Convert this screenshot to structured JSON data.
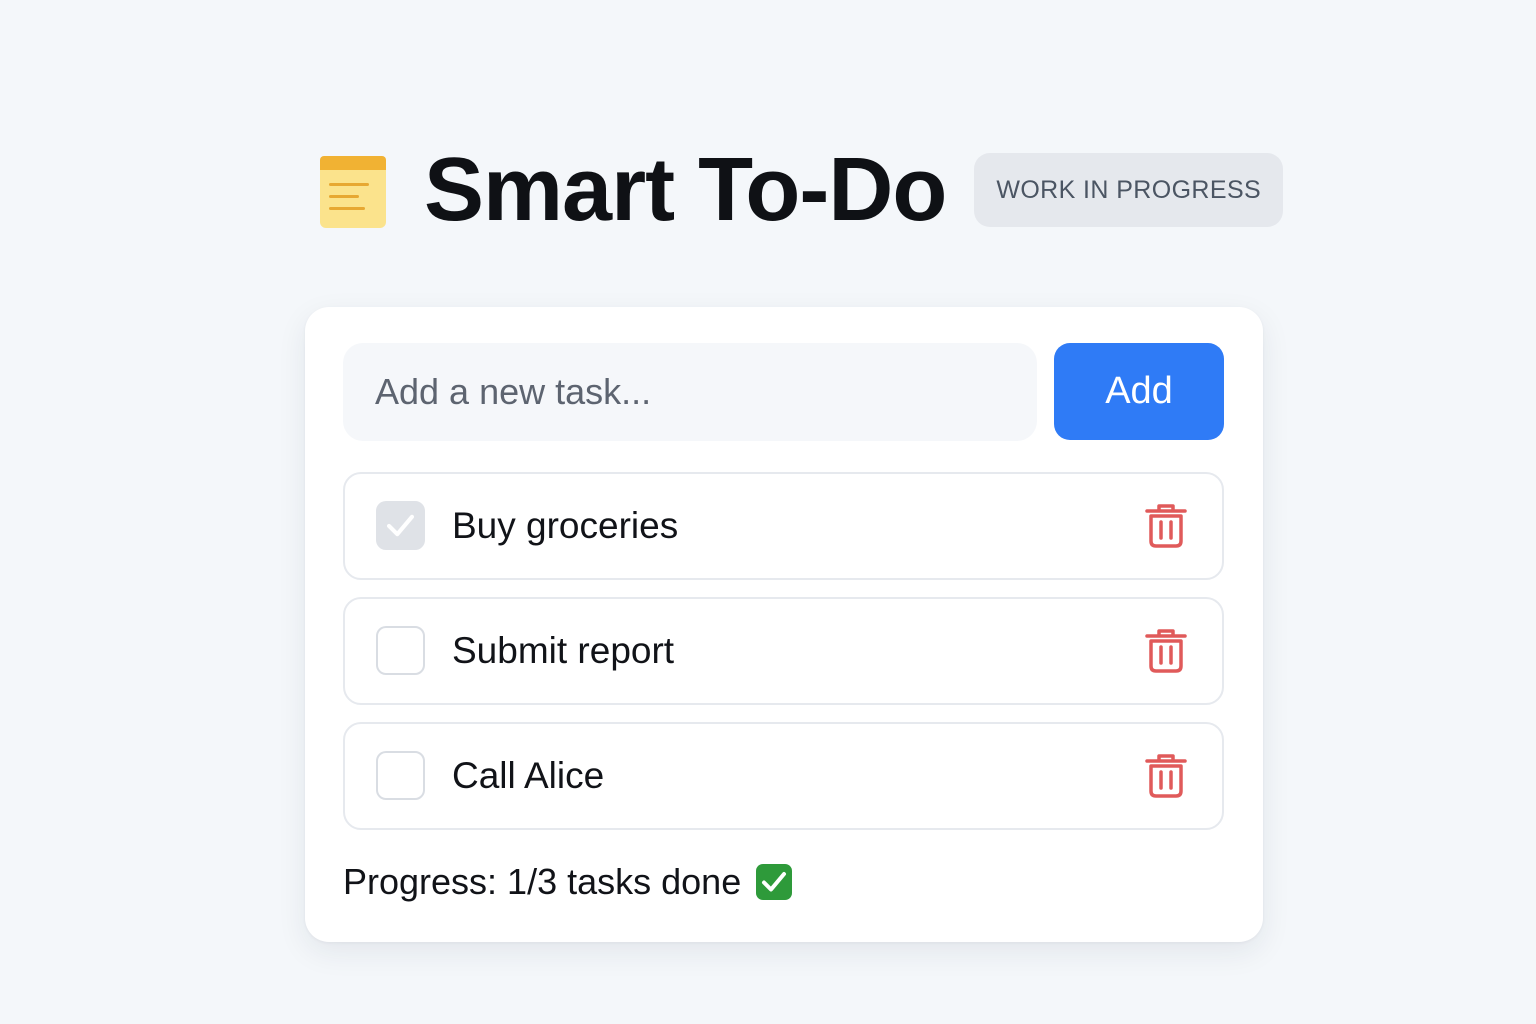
{
  "header": {
    "icon": "notepad-icon",
    "title": "Smart To-Do",
    "badge": "WORK IN PROGRESS"
  },
  "input": {
    "placeholder": "Add a new task...",
    "value": ""
  },
  "add_button": {
    "label": "Add"
  },
  "tasks": [
    {
      "label": "Buy groceries",
      "done": true
    },
    {
      "label": "Submit report",
      "done": false
    },
    {
      "label": "Call Alice",
      "done": false
    }
  ],
  "progress": {
    "text": "Progress: 1/3 tasks done",
    "icon": "check-mark-button-icon"
  },
  "colors": {
    "accent": "#2f7bf6",
    "delete": "#e05a5a",
    "done_icon": "#2e9a3a",
    "badge_bg": "#e5e8ed"
  }
}
